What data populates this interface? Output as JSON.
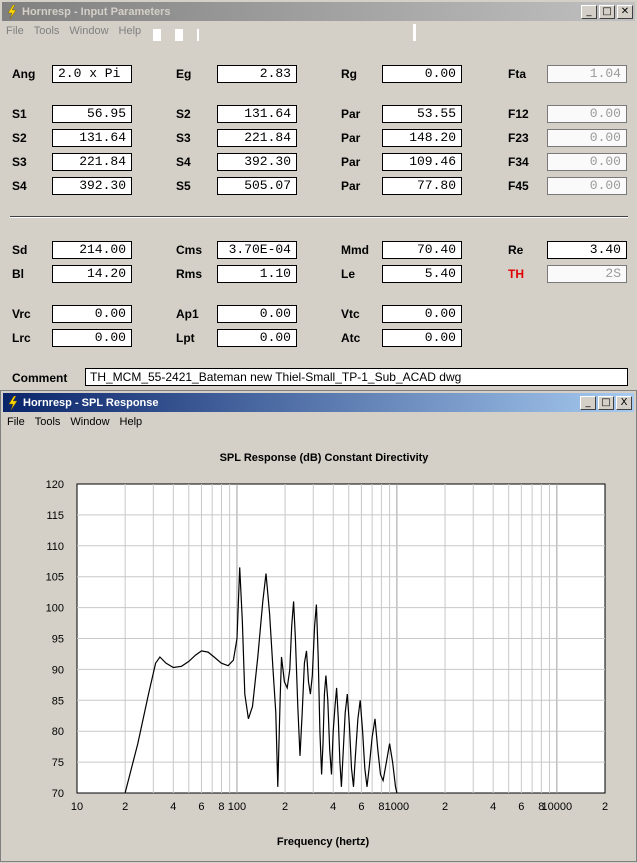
{
  "input_window": {
    "title": "Hornresp - Input Parameters",
    "menu": [
      "File",
      "Tools",
      "Window",
      "Help"
    ],
    "rows": [
      {
        "cols": [
          {
            "label": "Ang",
            "value": "2.0 x Pi"
          },
          {
            "label": "Eg",
            "value": "2.83"
          },
          {
            "label": "Rg",
            "value": "0.00"
          },
          {
            "label": "Fta",
            "value": "1.04"
          }
        ]
      },
      {
        "cols": [
          {
            "label": "S1",
            "value": "56.95"
          },
          {
            "label": "S2",
            "value": "131.64"
          },
          {
            "label": "Par",
            "value": "53.55"
          },
          {
            "label": "F12",
            "value": "0.00"
          }
        ]
      },
      {
        "cols": [
          {
            "label": "S2",
            "value": "131.64"
          },
          {
            "label": "S3",
            "value": "221.84"
          },
          {
            "label": "Par",
            "value": "148.20"
          },
          {
            "label": "F23",
            "value": "0.00"
          }
        ]
      },
      {
        "cols": [
          {
            "label": "S3",
            "value": "221.84"
          },
          {
            "label": "S4",
            "value": "392.30"
          },
          {
            "label": "Par",
            "value": "109.46"
          },
          {
            "label": "F34",
            "value": "0.00"
          }
        ]
      },
      {
        "cols": [
          {
            "label": "S4",
            "value": "392.30"
          },
          {
            "label": "S5",
            "value": "505.07"
          },
          {
            "label": "Par",
            "value": "77.80"
          },
          {
            "label": "F45",
            "value": "0.00"
          }
        ]
      },
      {
        "cols": [
          {
            "label": "Sd",
            "value": "214.00"
          },
          {
            "label": "Cms",
            "value": "3.70E-04"
          },
          {
            "label": "Mmd",
            "value": "70.40"
          },
          {
            "label": "Re",
            "value": "3.40"
          }
        ]
      },
      {
        "cols": [
          {
            "label": "Bl",
            "value": "14.20"
          },
          {
            "label": "Rms",
            "value": "1.10"
          },
          {
            "label": "Le",
            "value": "5.40"
          },
          {
            "label": "TH",
            "value": "2S"
          }
        ]
      },
      {
        "cols": [
          {
            "label": "Vrc",
            "value": "0.00"
          },
          {
            "label": "Ap1",
            "value": "0.00"
          },
          {
            "label": "Vtc",
            "value": "0.00"
          }
        ]
      },
      {
        "cols": [
          {
            "label": "Lrc",
            "value": "0.00"
          },
          {
            "label": "Lpt",
            "value": "0.00"
          },
          {
            "label": "Atc",
            "value": "0.00"
          }
        ]
      }
    ],
    "comment_label": "Comment",
    "comment_value": "TH_MCM_55-2421_Bateman new Thiel-Small_TP-1_Sub_ACAD dwg"
  },
  "spl_window": {
    "title": "Hornresp - SPL Response",
    "menu": [
      "File",
      "Tools",
      "Window",
      "Help"
    ],
    "window_buttons": [
      "_",
      "□",
      "X"
    ]
  },
  "chart_data": {
    "type": "line",
    "title": "SPL Response (dB)   Constant Directivity",
    "xlabel": "Frequency (hertz)",
    "ylabel": "",
    "x_scale": "log",
    "xlim": [
      10,
      20000
    ],
    "ylim": [
      70,
      120
    ],
    "x_tick_labels": [
      "10",
      "2",
      "4",
      "6",
      "8",
      "100",
      "2",
      "4",
      "6",
      "8",
      "1000",
      "2",
      "4",
      "6",
      "8",
      "10000",
      "2"
    ],
    "y_ticks": [
      70,
      75,
      80,
      85,
      90,
      95,
      100,
      105,
      110,
      115,
      120
    ],
    "grid": true,
    "line_color": "#000000",
    "series": [
      {
        "points": [
          [
            20,
            70
          ],
          [
            24,
            78
          ],
          [
            28,
            86
          ],
          [
            31,
            91
          ],
          [
            33,
            92
          ],
          [
            36,
            91
          ],
          [
            40,
            90.3
          ],
          [
            45,
            90.5
          ],
          [
            50,
            91.3
          ],
          [
            55,
            92.3
          ],
          [
            60,
            93
          ],
          [
            66,
            92.8
          ],
          [
            72,
            92
          ],
          [
            80,
            91
          ],
          [
            88,
            90.6
          ],
          [
            95,
            91.5
          ],
          [
            100,
            95
          ],
          [
            104,
            106.5
          ],
          [
            108,
            98
          ],
          [
            112,
            86
          ],
          [
            118,
            82
          ],
          [
            125,
            84
          ],
          [
            135,
            92
          ],
          [
            145,
            101
          ],
          [
            152,
            105.5
          ],
          [
            160,
            99
          ],
          [
            168,
            90
          ],
          [
            175,
            83
          ],
          [
            180,
            71
          ],
          [
            186,
            85
          ],
          [
            190,
            92
          ],
          [
            198,
            88
          ],
          [
            206,
            87
          ],
          [
            214,
            90
          ],
          [
            220,
            97
          ],
          [
            226,
            101
          ],
          [
            232,
            95
          ],
          [
            240,
            84
          ],
          [
            248,
            76
          ],
          [
            256,
            83
          ],
          [
            264,
            91
          ],
          [
            272,
            93
          ],
          [
            280,
            88
          ],
          [
            288,
            86
          ],
          [
            296,
            89
          ],
          [
            306,
            97
          ],
          [
            314,
            100.5
          ],
          [
            322,
            92
          ],
          [
            330,
            80
          ],
          [
            338,
            73
          ],
          [
            345,
            78
          ],
          [
            352,
            86
          ],
          [
            360,
            89
          ],
          [
            370,
            85
          ],
          [
            380,
            77
          ],
          [
            390,
            73
          ],
          [
            400,
            80
          ],
          [
            410,
            84
          ],
          [
            420,
            87
          ],
          [
            430,
            82
          ],
          [
            440,
            75
          ],
          [
            450,
            71
          ],
          [
            460,
            76
          ],
          [
            475,
            83
          ],
          [
            490,
            86
          ],
          [
            505,
            81
          ],
          [
            520,
            74
          ],
          [
            535,
            71
          ],
          [
            550,
            76
          ],
          [
            570,
            82
          ],
          [
            590,
            85
          ],
          [
            610,
            80
          ],
          [
            630,
            74
          ],
          [
            650,
            71
          ],
          [
            670,
            74
          ],
          [
            700,
            79
          ],
          [
            730,
            82
          ],
          [
            760,
            77
          ],
          [
            790,
            73
          ],
          [
            820,
            72
          ],
          [
            860,
            75
          ],
          [
            900,
            78
          ],
          [
            940,
            75
          ],
          [
            980,
            71
          ],
          [
            1000,
            70
          ]
        ]
      }
    ]
  }
}
